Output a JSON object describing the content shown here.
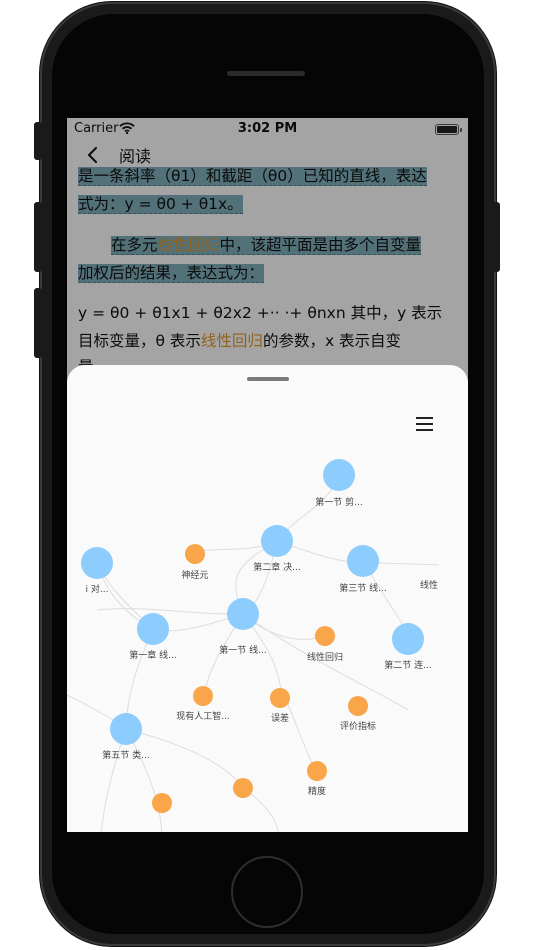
{
  "status_bar": {
    "carrier": "Carrier",
    "time": "3:02 PM"
  },
  "nav": {
    "title": "阅读"
  },
  "reader": {
    "line1": "是一条斜率（θ1）和截距（θ0）已知的直线，表达",
    "line2": "式为：y = θ0 + θ1x。",
    "line3_pre": "在多元",
    "line3_kw": "线性回归",
    "line3_post": "中，该超平面是由多个自变量",
    "line4": "加权后的结果，表达式为：",
    "line5": "y = θ0 + θ1x1 + θ2x2 +·· ·+ θnxn 其中，y 表示",
    "line6_pre": "目标变量，θ 表示",
    "line6_kw": "线性回归",
    "line6_post": "的参数，x 表示自变",
    "line7": "量"
  },
  "graph": {
    "colors": {
      "chapter": "#8dcdfd",
      "concept": "#f9a64a",
      "edge": "#dddddd"
    },
    "nodes": {
      "n1": "第一节 剪...",
      "n2": "第二章 决...",
      "n3": "神经元",
      "n4": "第三节 线...",
      "n5": "线性",
      "n6": "i 对...",
      "n7": "第一章 线...",
      "n8": "第一节 线...",
      "n9": "线性回归",
      "n10": "第二节 连...",
      "n11": "现有人工智...",
      "n12": "误差",
      "n13": "评价指标",
      "n14": "第五节 类...",
      "n15": "精度"
    }
  }
}
